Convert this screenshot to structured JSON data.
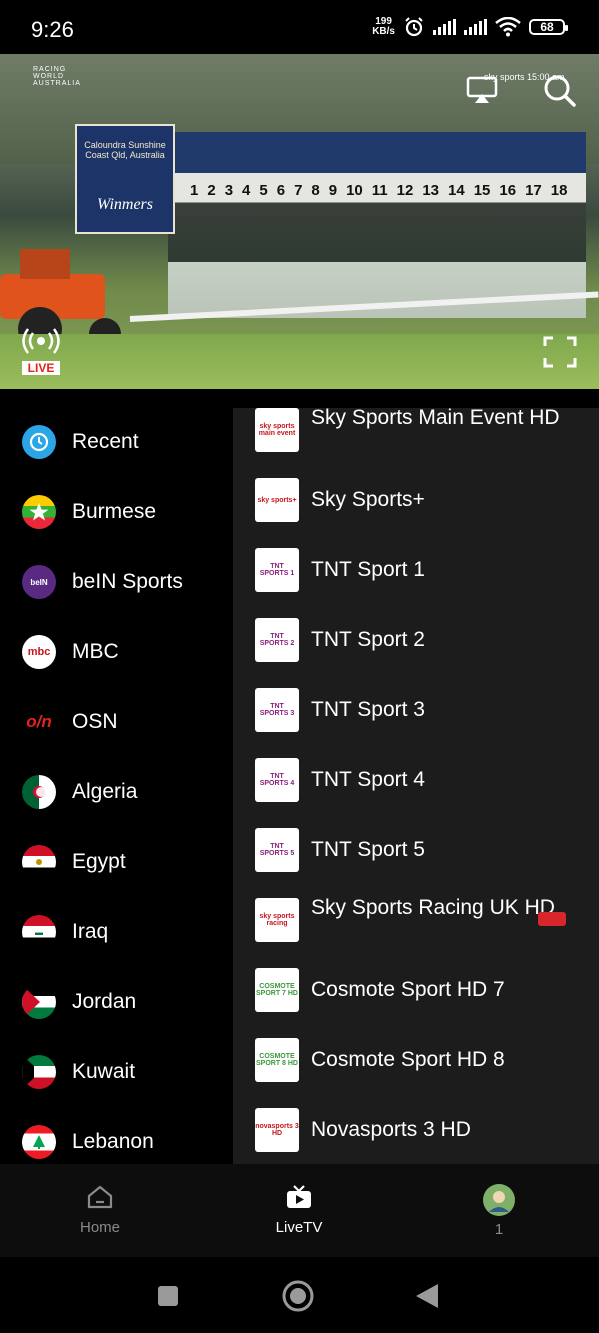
{
  "status_bar": {
    "time": "9:26",
    "net_speed_value": "199",
    "net_speed_unit": "KB/s",
    "battery": "68"
  },
  "player": {
    "logo_text": "RACING WORLD AUSTRALIA",
    "banner_location": "Caloundra Sunshine Coast Qld, Australia",
    "banner_brand": "Winmers",
    "stall_numbers": [
      "1",
      "2",
      "3",
      "4",
      "5",
      "6",
      "7",
      "8",
      "9",
      "10",
      "11",
      "12",
      "13",
      "14",
      "15",
      "16",
      "17",
      "18"
    ],
    "sky_ticker": "sky sports 15:00 am",
    "live_label": "LIVE"
  },
  "categories": [
    {
      "label": "Recent",
      "icon": "recent-icon"
    },
    {
      "label": "Burmese",
      "icon": "myanmar-flag-icon"
    },
    {
      "label": "beIN Sports",
      "icon": "bein-sports-icon"
    },
    {
      "label": "MBC",
      "icon": "mbc-icon"
    },
    {
      "label": "OSN",
      "icon": "osn-icon"
    },
    {
      "label": "Algeria",
      "icon": "algeria-flag-icon"
    },
    {
      "label": "Egypt",
      "icon": "egypt-flag-icon"
    },
    {
      "label": "Iraq",
      "icon": "iraq-flag-icon"
    },
    {
      "label": "Jordan",
      "icon": "jordan-flag-icon"
    },
    {
      "label": "Kuwait",
      "icon": "kuwait-flag-icon"
    },
    {
      "label": "Lebanon",
      "icon": "lebanon-flag-icon"
    }
  ],
  "channels": [
    {
      "name": "Sky Sports Main Event HD",
      "logo": "sky sports main event"
    },
    {
      "name": "Sky Sports+",
      "logo": "sky sports+"
    },
    {
      "name": "TNT Sport 1",
      "logo": "TNT SPORTS 1"
    },
    {
      "name": "TNT Sport 2",
      "logo": "TNT SPORTS 2"
    },
    {
      "name": "TNT Sport 3",
      "logo": "TNT SPORTS 3"
    },
    {
      "name": "TNT Sport 4",
      "logo": "TNT SPORTS 4"
    },
    {
      "name": "TNT Sport 5",
      "logo": "TNT SPORTS 5"
    },
    {
      "name": "Sky Sports Racing UK HD",
      "logo": "sky sports racing",
      "flag": "canada-flag-icon"
    },
    {
      "name": "Cosmote Sport HD 7",
      "logo": "COSMOTE SPORT 7 HD"
    },
    {
      "name": "Cosmote Sport HD 8",
      "logo": "COSMOTE SPORT 8 HD"
    },
    {
      "name": "Novasports 3 HD",
      "logo": "novasports 3 HD"
    }
  ],
  "bottom_nav": {
    "home": "Home",
    "livetv": "LiveTV",
    "profile": "1"
  },
  "colors": {
    "background": "#000000",
    "channel_panel": "#1c1c1c",
    "accent_live": "#e0241b"
  }
}
